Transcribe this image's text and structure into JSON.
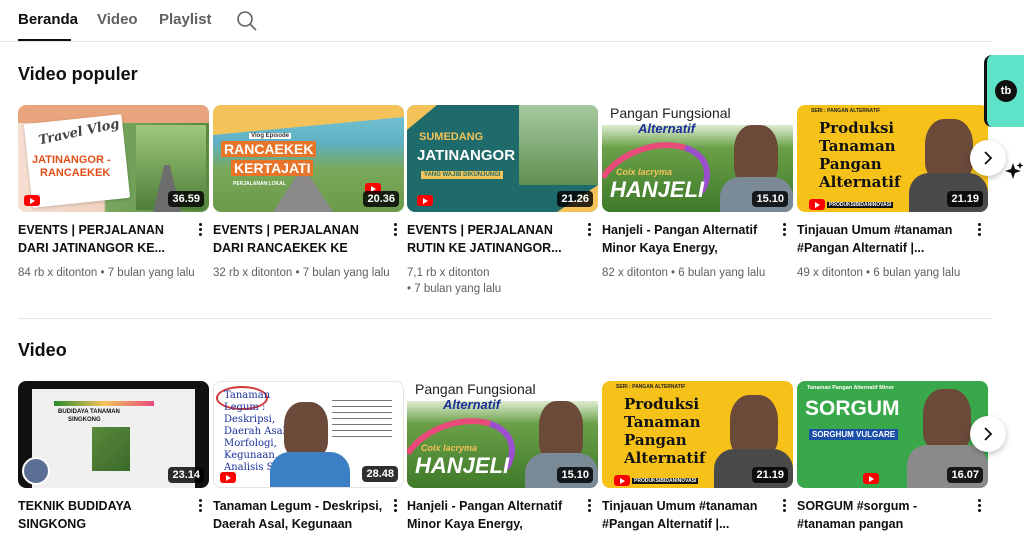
{
  "tabs": [
    {
      "label": "Beranda",
      "active": true
    },
    {
      "label": "Video",
      "active": false
    },
    {
      "label": "Playlist",
      "active": false
    }
  ],
  "search_icon": "search-icon",
  "sections": {
    "popular": {
      "title": "Video populer",
      "videos": [
        {
          "title": "EVENTS | PERJALANAN DARI JATINANGOR KE...",
          "views": "84 rb x ditonton",
          "age": "7 bulan yang lalu",
          "duration": "36.59",
          "thumb": {
            "line1": "Travel Vlog",
            "line2": "JATINANGOR -",
            "line3": "RANCAEKEK"
          }
        },
        {
          "title": "EVENTS | PERJALANAN DARI RANCAEKEK KE KERTAJATI...",
          "views": "32 rb x ditonton",
          "age": "7 bulan yang lalu",
          "duration": "20.36",
          "thumb": {
            "line1": "Vlog Episode",
            "line2": "RANCAEKEK",
            "line3": "KERTAJATI",
            "line4": "PERJALANAN LOKAL"
          }
        },
        {
          "title": "EVENTS | PERJALANAN RUTIN KE JATINANGOR...",
          "views": "7,1 rb x ditonton",
          "age": "7 bulan yang lalu",
          "duration": "21.26",
          "thumb": {
            "line1": "SUMEDANG",
            "line2": "JATINANGOR",
            "line3": "YANG WAJIB DIKUNJUNGI"
          }
        },
        {
          "title": "Hanjeli - Pangan Alternatif Minor Kaya Energy, pangan...",
          "views": "82 x ditonton",
          "age": "6 bulan yang lalu",
          "duration": "15.10",
          "thumb": {
            "line1": "Pangan Fungsional",
            "line2": "Alternatif",
            "line3": "Coix lacryma",
            "line4": "HANJELI"
          }
        },
        {
          "title": "Tinjauan Umum #tanaman #Pangan Alternatif |...",
          "views": "49 x ditonton",
          "age": "6 bulan yang lalu",
          "duration": "21.19",
          "thumb": {
            "line1": "SERI : PANGAN ALTERNATIF",
            "line2": "Produksi",
            "line3": "Tanaman",
            "line4": "Pangan",
            "line5": "Alternatif",
            "line6": "PRODUKSIBIDANINOVASI"
          }
        }
      ]
    },
    "videos": {
      "title": "Video",
      "videos": [
        {
          "title": "TEKNIK BUDIDAYA SINGKONG",
          "duration": "23.14",
          "thumb": {
            "line1": "BUDIDAYA TANAMAN",
            "line2": "SINGKONG"
          }
        },
        {
          "title": "Tanaman Legum - Deskripsi, Daerah Asal, Kegunaan dan...",
          "duration": "28.48",
          "thumb": {
            "line1": "Tanaman",
            "line2": "Legum :",
            "line3": "Deskripsi,",
            "line4": "Daerah Asal,",
            "line5": "Morfologi,",
            "line6": "Kegunaan,",
            "line7": "Analisis SWOT"
          }
        },
        {
          "title": "Hanjeli - Pangan Alternatif Minor Kaya Energy, pangan...",
          "duration": "15.10",
          "thumb": {
            "line1": "Pangan Fungsional",
            "line2": "Alternatif",
            "line3": "Coix lacryma",
            "line4": "HANJELI"
          }
        },
        {
          "title": "Tinjauan Umum #tanaman #Pangan Alternatif |...",
          "duration": "21.19",
          "thumb": {
            "line1": "SERI : PANGAN ALTERNATIF",
            "line2": "Produksi",
            "line3": "Tanaman",
            "line4": "Pangan",
            "line5": "Alternatif",
            "line6": "PRODUKSIBIDANINOVASI"
          }
        },
        {
          "title": "SORGUM #sorgum - #tanaman pangan #alternat...",
          "duration": "16.07",
          "thumb": {
            "line1": "Tanaman Pangan Alternatif Minor",
            "line2": "SORGUM",
            "line3": "SORGHUM VULGARE"
          }
        }
      ]
    }
  },
  "side_widget": {
    "logo_text": "tb"
  },
  "colors": {
    "accent": "#ff0000",
    "text_primary": "#0f0f0f",
    "text_secondary": "#606060",
    "widget": "#5ee3c8"
  }
}
